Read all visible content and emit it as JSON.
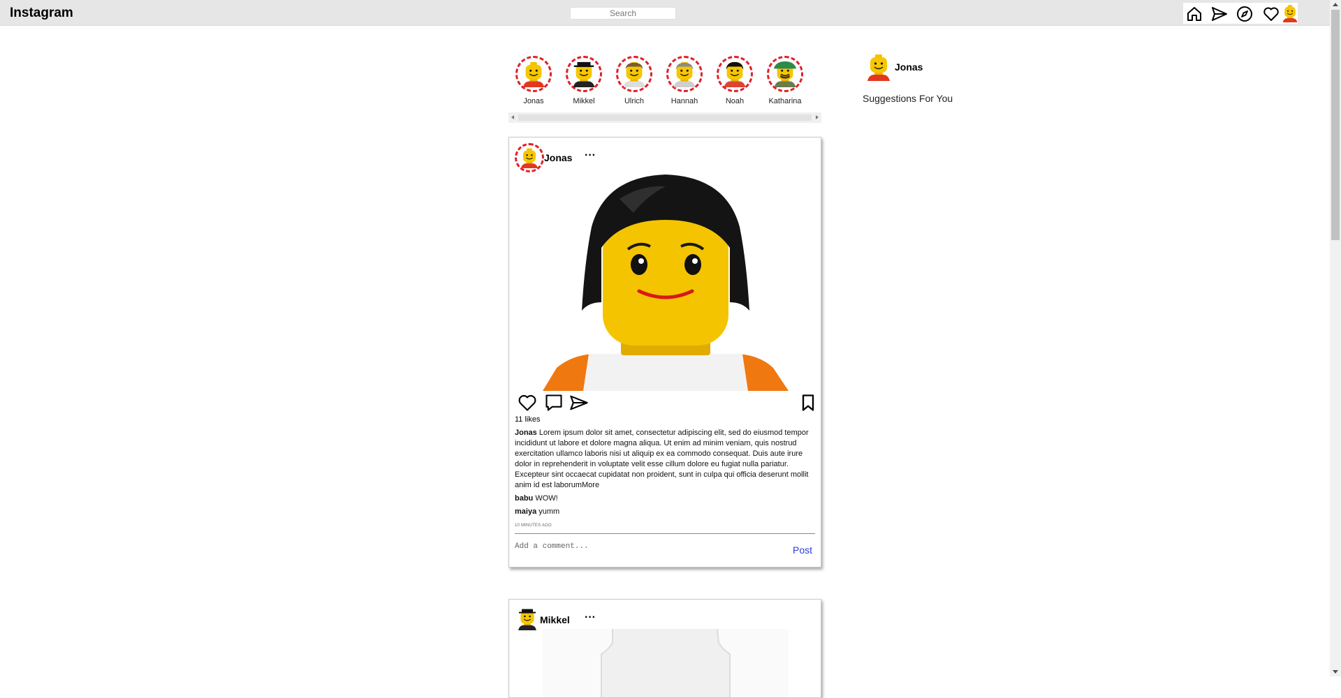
{
  "app": {
    "title": "Instagram"
  },
  "search": {
    "placeholder": "Search"
  },
  "nav": [
    "home-icon",
    "direct-icon",
    "explore-icon",
    "activity-icon",
    "profile-avatar"
  ],
  "stories": [
    {
      "name": "Jonas",
      "hat": "none",
      "hair": "none",
      "face": "smile"
    },
    {
      "name": "Mikkel",
      "hat": "black",
      "hair": "none",
      "face": "smile"
    },
    {
      "name": "Ulrich",
      "hat": "none",
      "hair": "brown",
      "face": "serious"
    },
    {
      "name": "Hannah",
      "hat": "none",
      "hair": "gray",
      "face": "smile"
    },
    {
      "name": "Noah",
      "hat": "none",
      "hair": "black",
      "face": "smile"
    },
    {
      "name": "Katharina",
      "hat": "green",
      "hair": "none",
      "face": "beard"
    }
  ],
  "sidebar": {
    "username": "Jonas",
    "suggestions_label": "Suggestions For You"
  },
  "posts": [
    {
      "username": "Jonas",
      "more": "···",
      "likes": "11 likes",
      "caption_user": "Jonas",
      "caption_text": "Lorem ipsum dolor sit amet, consectetur adipiscing elit, sed do eiusmod tempor incididunt ut labore et dolore magna aliqua. Ut enim ad minim veniam, quis nostrud exercitation ullamco laboris nisi ut aliquip ex ea commodo consequat. Duis aute irure dolor in reprehenderit in voluptate velit esse cillum dolore eu fugiat nulla pariatur. Excepteur sint occaecat cupidatat non proident, sunt in culpa qui officia deserunt mollit anim id est laborum",
      "caption_more": "More",
      "comments": [
        {
          "user": "babu",
          "text": "WOW!"
        },
        {
          "user": "maiya",
          "text": "yumm"
        }
      ],
      "time": "10 minutes ago",
      "comment_placeholder": "Add a comment...",
      "post_label": "Post"
    },
    {
      "username": "Mikkel",
      "more": "···"
    }
  ],
  "colors": {
    "story_ring": "#e0202a",
    "post_link": "#2a3bd6",
    "topbar": "#e6e6e6"
  }
}
